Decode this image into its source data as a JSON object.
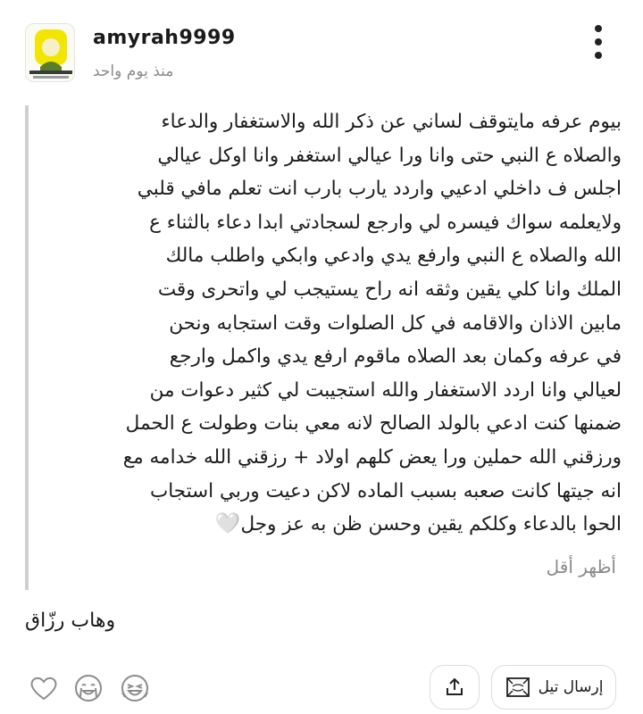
{
  "post": {
    "username": "amyrah9999",
    "timestamp": "منذ يوم واحد",
    "lines": [
      "بيوم عرفه مايتوقف لساني عن ذكر الله والاستغفار والدعاء",
      "والصلاه ع النبي حتى وانا ورا عيالي استغفر وانا اوكل عيالي",
      "اجلس ف داخلي ادعيي واردد يارب بارب انت تعلم مافي قلبي",
      "ولايعلمه سواك فيسره لي وارجع لسجادتي ابدا دعاء بالثناء ع",
      "الله والصلاه ع النبي وارفع يدي وادعي  وابكي واطلب مالك",
      "الملك وانا كلي يقين وثقه انه راح يستيجب لي واتحرى وقت",
      "مابين الاذان والاقامه في كل الصلوات وقت استجابه ونحن",
      "في عرفه وكمان بعد الصلاه ماقوم ارفع يدي واكمل وارجع",
      "لعيالي وانا اردد الاستغفار والله استجيبت لي كثير دعوات من",
      "ضمنها كنت ادعي بالولد الصالح لانه معي بنات وطولت ع الحمل",
      "ورزقني الله حملين ورا يعض كلهم اولاد + رزقني الله خدامه مع",
      "انه جيتها كانت صعبه بسبب الماده لاكن دعيت وربي استجاب",
      "الحوا بالدعاء وكلكم يقين وحسن ظن به عز وجل"
    ],
    "last_line_emoji": "🤍",
    "show_less_label": "أظهر أقل",
    "comment_text": "وهاب رزّاق"
  },
  "actions": {
    "send_label": "إرسال تيل"
  },
  "icons": {
    "more": "more-vertical-icon",
    "like": "heart-icon",
    "reaction_2": "crying-face-icon",
    "reaction_3": "laughing-face-icon",
    "share": "share-icon",
    "send": "tile-icon"
  }
}
